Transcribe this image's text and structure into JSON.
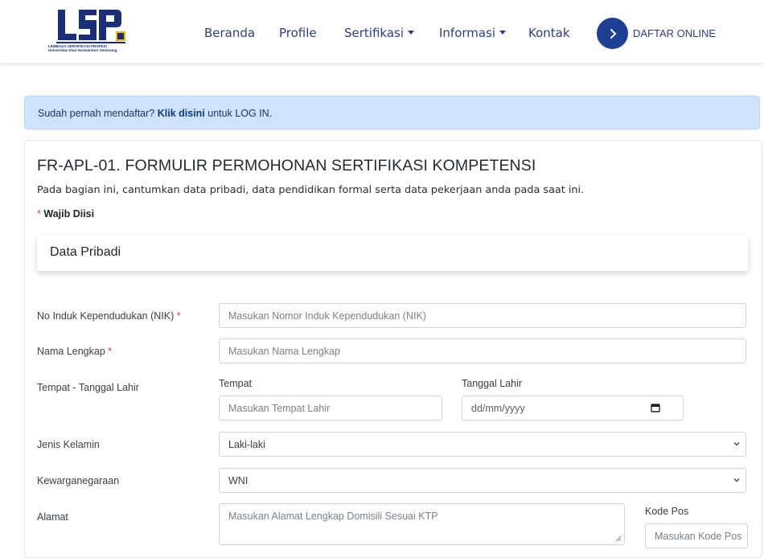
{
  "nav": {
    "logo_lines": [
      "LEMBAGA SERTIFIKASI PROFESI",
      "Universitas Dian Nuswantoro Semarang"
    ],
    "items": [
      {
        "label": "Beranda"
      },
      {
        "label": "Profile"
      },
      {
        "label": "Sertifikasi",
        "dropdown": true
      },
      {
        "label": "Informasi",
        "dropdown": true
      },
      {
        "label": "Kontak"
      }
    ],
    "cta_label": "DAFTAR ONLINE",
    "cta_icon": "chevron-right-icon",
    "brand_color": "#1d3f94"
  },
  "alert": {
    "prefix": "Sudah pernah mendaftar?",
    "link": "Klik disini",
    "suffix": "untuk LOG IN.",
    "bg_color": "#cfe2ff"
  },
  "form": {
    "title": "FR-APL-01. FORMULIR PERMOHONAN SERTIFIKASI KOMPETENSI",
    "description": "Pada bagian ini, cantumkan data pribadi, data pendidikan formal serta data pekerjaan anda pada saat ini.",
    "required_star": "*",
    "required_label": "Wajib Diisi",
    "section_title": "Data Pribadi",
    "fields": {
      "nik": {
        "label": "No Induk Kependudukan (NIK)",
        "required": "*",
        "placeholder": "Masukan Nomor Induk Kependudukan (NIK)"
      },
      "nama": {
        "label": "Nama Lengkap",
        "required": "*",
        "placeholder": "Masukan Nama Lengkap"
      },
      "ttl": {
        "label": "Tempat - Tanggal Lahir",
        "tempat_label": "Tempat",
        "tempat_placeholder": "Masukan Tempat Lahir",
        "tanggal_label": "Tanggal Lahir",
        "tanggal_placeholder": "dd/mm/yyyy"
      },
      "jenis_kelamin": {
        "label": "Jenis Kelamin",
        "value": "Laki-laki"
      },
      "kewarganegaraan": {
        "label": "Kewarganegaraan",
        "value": "WNI"
      },
      "alamat": {
        "label": "Alamat",
        "placeholder": "Masukan Alamat Lengkap Domisili Sesuai KTP"
      },
      "kode_pos": {
        "label": "Kode Pos",
        "placeholder": "Masukan Kode Pos"
      }
    }
  }
}
